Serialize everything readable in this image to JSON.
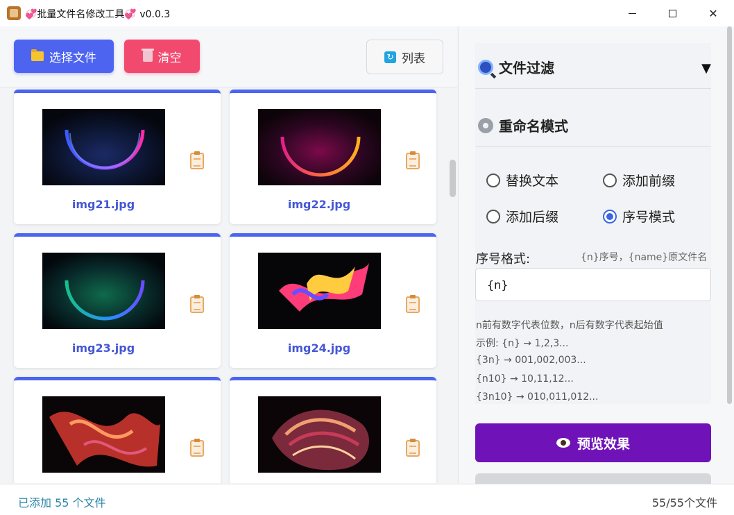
{
  "window": {
    "title": "💞批量文件名修改工具💞 v0.0.3",
    "minimize_label": "—",
    "maximize_label": "☐",
    "close_label": "✕"
  },
  "toolbar": {
    "select_files_label": "选择文件",
    "clear_label": "清空",
    "list_label": "列表",
    "icons": [
      "folder-icon",
      "trash-icon",
      "refresh-icon"
    ]
  },
  "files": [
    {
      "name": "img21.jpg",
      "thumb_colors": [
        "#0c1020",
        "#3a5cff",
        "#ff2aa8"
      ]
    },
    {
      "name": "img22.jpg",
      "thumb_colors": [
        "#14060e",
        "#e0208a",
        "#ffb020"
      ]
    },
    {
      "name": "img23.jpg",
      "thumb_colors": [
        "#041018",
        "#16c08a",
        "#3c6cff"
      ]
    },
    {
      "name": "img24.jpg",
      "thumb_colors": [
        "#060608",
        "#ff3c7a",
        "#ffcc40"
      ]
    },
    {
      "name": "",
      "thumb_colors": [
        "#0a0506",
        "#d6402a",
        "#ff9a60"
      ]
    },
    {
      "name": "",
      "thumb_colors": [
        "#0b0508",
        "#c83a5a",
        "#f0a070"
      ]
    }
  ],
  "right_panel": {
    "filter_section_title": "文件过滤",
    "filter_toggle": "▼",
    "rename_section_title": "重命名模式",
    "modes": [
      {
        "label": "替换文本",
        "checked": false
      },
      {
        "label": "添加前缀",
        "checked": false
      },
      {
        "label": "添加后缀",
        "checked": false
      },
      {
        "label": "序号模式",
        "checked": true
      }
    ],
    "format_label": "序号格式:",
    "format_hint": "{n}序号，{name}原文件名",
    "format_value": "{n}",
    "help_lines": [
      "n前有数字代表位数，n后有数字代表起始值",
      "示例: {n} → 1,2,3...",
      "{3n} → 001,002,003...",
      "{n10} → 10,11,12...",
      "{3n10} → 010,011,012..."
    ],
    "preview_button_label": "预览效果"
  },
  "status": {
    "added_text": "已添加 55 个文件",
    "count_text": "55/55个文件"
  },
  "colors": {
    "accent_blue": "#4d64f0",
    "danger_pink": "#f24a6f",
    "preview_purple": "#6f13b8",
    "filename_blue": "#4557d6"
  }
}
